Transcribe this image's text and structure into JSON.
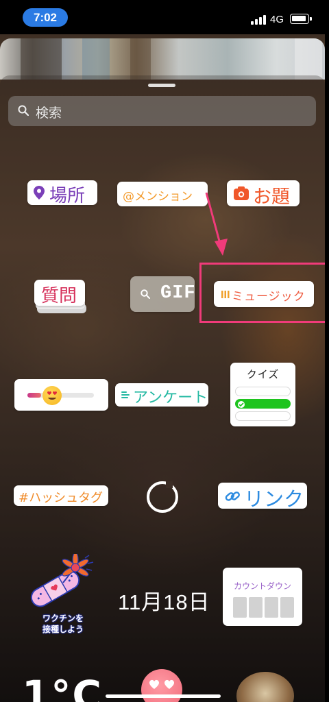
{
  "status_bar": {
    "time": "7:02",
    "network": "4G"
  },
  "search": {
    "placeholder": "検索"
  },
  "stickers": {
    "location": "場所",
    "mention": "@メンション",
    "prompt": "お題",
    "question": "質問",
    "gif": "GIF",
    "music": "ミュージック",
    "slider": {
      "emoji": "heart-eyes-emoji",
      "level": 0.2
    },
    "poll": "アンケート",
    "quiz": {
      "title": "クイズ",
      "correct_option": 2,
      "option_count": 3
    },
    "hashtag": "#ハッシュタグ",
    "link": "リンク",
    "vaccine": {
      "line1": "ワクチンを",
      "line2": "接種しよう"
    },
    "date": "11月18日",
    "countdown": "カウントダウン",
    "temperature": "1°C"
  },
  "colors": {
    "highlight": "#f03b7a",
    "time_pill": "#2b7be4",
    "location": "#7a3fb8",
    "music": "#ee5a3f",
    "link": "#2d8be0",
    "poll": "#25b9a3"
  }
}
